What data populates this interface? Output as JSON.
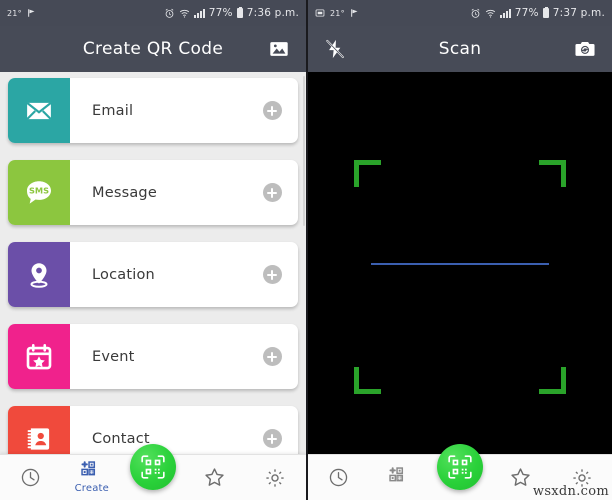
{
  "theme": {
    "status_bar_bg": "#464a56",
    "app_bar_bg": "#474b57",
    "page_bg": "#ececec",
    "fab_green": "#2ad13a",
    "accent_blue": "#3b5fb0",
    "bracket_green": "#2aa32a",
    "scanline_blue": "#3b5fb0"
  },
  "left": {
    "status": {
      "temperature": "21°",
      "flag_icon": "flag-icon",
      "alarm_icon": "alarm-icon",
      "wifi_icon": "wifi-icon",
      "signal_icon": "signal-bars-icon",
      "battery_percent": "77%",
      "battery_icon": "battery-icon",
      "time": "7:36 p.m."
    },
    "appbar": {
      "title": "Create QR Code",
      "action_icon": "image-gallery-icon"
    },
    "items": [
      {
        "label": "Email",
        "icon": "envelope-icon",
        "color": "#2ba6a4",
        "add_icon": "plus-circle-icon"
      },
      {
        "label": "Message",
        "icon": "sms-bubble-icon",
        "color": "#8cc63f",
        "add_icon": "plus-circle-icon"
      },
      {
        "label": "Location",
        "icon": "map-pin-icon",
        "color": "#6b4fa8",
        "add_icon": "plus-circle-icon"
      },
      {
        "label": "Event",
        "icon": "calendar-star-icon",
        "color": "#f0228c",
        "add_icon": "plus-circle-icon"
      },
      {
        "label": "Contact",
        "icon": "contact-card-icon",
        "color": "#f04a3c",
        "add_icon": "plus-circle-icon"
      }
    ],
    "nav": {
      "history_icon": "clock-icon",
      "create_icon": "qr-add-icon",
      "create_label": "Create",
      "scan_icon": "qr-scan-icon",
      "favorites_icon": "star-icon",
      "settings_icon": "gear-icon"
    }
  },
  "right": {
    "status": {
      "screenshot_icon": "screenshot-icon",
      "temperature": "21°",
      "flag_icon": "flag-icon",
      "alarm_icon": "alarm-icon",
      "wifi_icon": "wifi-icon",
      "signal_icon": "signal-bars-icon",
      "battery_percent": "77%",
      "battery_icon": "battery-icon",
      "time": "7:37 p.m."
    },
    "appbar": {
      "title": "Scan",
      "left_icon": "flash-off-icon",
      "right_icon": "camera-flip-icon"
    },
    "scan": {
      "corner_icon": "viewfinder-corner",
      "scanline_icon": "scan-line"
    },
    "nav": {
      "history_icon": "clock-icon",
      "create_icon": "qr-add-icon",
      "scan_icon": "qr-scan-icon",
      "favorites_icon": "star-icon",
      "settings_icon": "gear-icon"
    },
    "watermark": "wsxdn.com"
  }
}
